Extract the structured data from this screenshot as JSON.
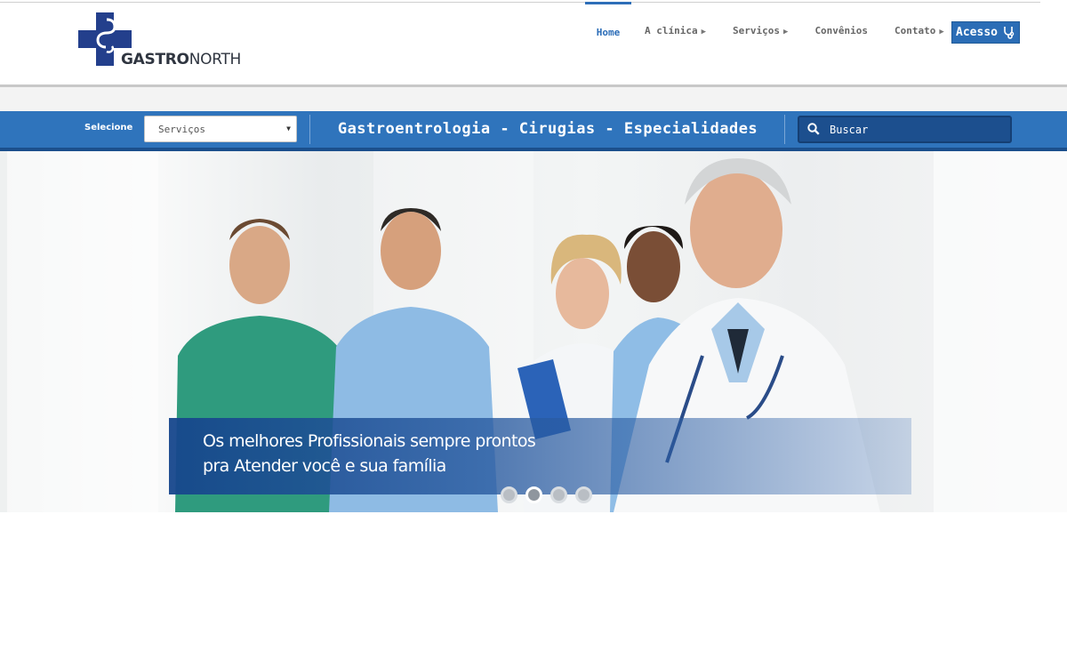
{
  "brand": {
    "name_bold": "GASTRO",
    "name_rest": "NORTH",
    "color": "#233f8c"
  },
  "nav": {
    "items": [
      {
        "label": "Home",
        "active": true
      },
      {
        "label": "A clínica",
        "arrow": "▶"
      },
      {
        "label": "Serviços",
        "arrow": "▶"
      },
      {
        "label": "Convênios"
      },
      {
        "label": "Contato",
        "arrow": "▶"
      }
    ],
    "access_label": "Acesso",
    "access_icon": "stethoscope-icon"
  },
  "toolbar": {
    "select_label": "Selecione",
    "select_value": "Serviços",
    "tagline": "Gastroentrologia - Cirugias - Especialidades",
    "search_placeholder": "Buscar",
    "search_icon": "search-icon"
  },
  "hero": {
    "caption_line1": "Os melhores Profissionais sempre prontos",
    "caption_line2": "pra Atender você e sua família",
    "slides": 4,
    "active_slide": 2
  },
  "colors": {
    "primary": "#2f74bc",
    "dark": "#1b4f8c",
    "accent": "#2d6eb8"
  }
}
